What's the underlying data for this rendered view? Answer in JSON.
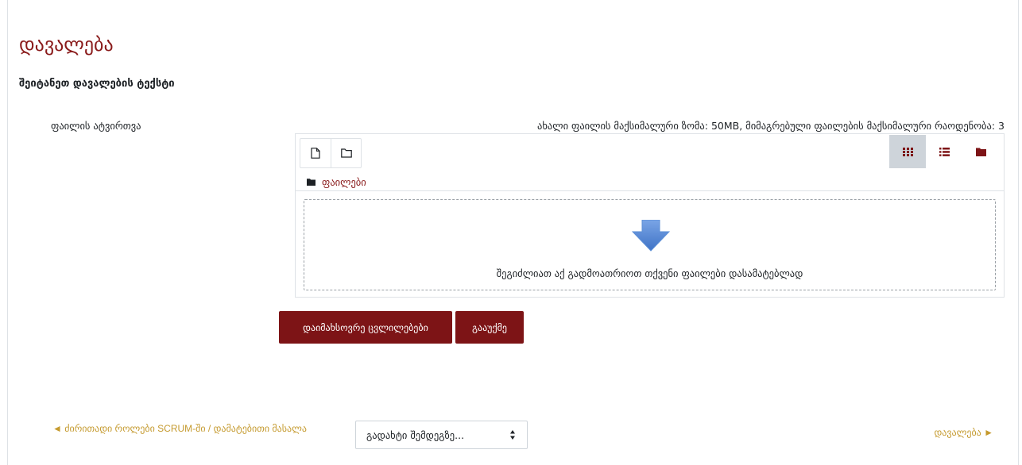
{
  "page": {
    "title": "დავალება",
    "section_heading": "შეიტანეთ დავალების ტექსტი"
  },
  "file_upload": {
    "label": "ფაილის ატვირთვა",
    "limits": "ახალი ფაილის მაქსიმალური ზომა: 50MB, მიმაგრებული ფაილების მაქსიმალური რაოდენობა: 3",
    "toolbar": {
      "add_file_icon": "file-icon",
      "create_folder_icon": "folder-outline-icon",
      "views": [
        {
          "icon": "grid-icon",
          "active": true
        },
        {
          "icon": "list-icon",
          "active": false
        },
        {
          "icon": "folder-tree-icon",
          "active": false
        }
      ]
    },
    "path_label": "ფაილები",
    "dropzone_text": "შეგიძლიათ აქ გადმოათრიოთ თქვენი ფაილები დასამატებლად"
  },
  "actions": {
    "save_label": "დაიმახსოვრე ცვლილებები",
    "cancel_label": "გააუქმე"
  },
  "navigation": {
    "prev_label": "◄ ძირითადი როლები SCRUM-ში / დამატებითი მასალა",
    "jump_select_value": "გადახტი შემდეგზე...",
    "next_label": "დავალება ►"
  },
  "colors": {
    "accent": "#7d1416",
    "link": "#8a1b1b",
    "nav_link": "#c59a2e",
    "active_view_bg": "#ced4da",
    "arrow": "#5b8ed6"
  }
}
